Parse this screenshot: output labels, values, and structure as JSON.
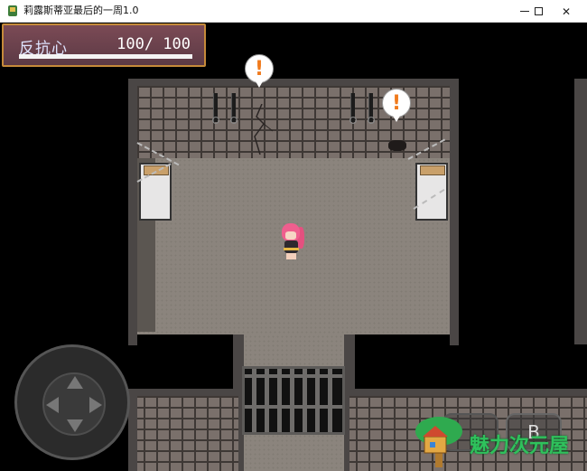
{
  "window": {
    "title": "莉露斯蒂亚最后的一周1.0",
    "controls": {
      "minimize": "minimize",
      "maximize": "maximize",
      "close": "close"
    }
  },
  "hud": {
    "label": "反抗心",
    "value_text": "100/ 100",
    "current": 100,
    "max": 100,
    "bar_fill_fraction": 1.0
  },
  "scene": {
    "alerts": [
      "!",
      "!"
    ],
    "gate": "cell-gate"
  },
  "controls": {
    "b_button_label": "B"
  },
  "watermark": {
    "text": "魅力次元屋"
  },
  "colors": {
    "hud_border": "#c58a3a",
    "hud_bg": "#6b4350",
    "alert": "#f07a1c",
    "watermark": "#2fc15c"
  }
}
